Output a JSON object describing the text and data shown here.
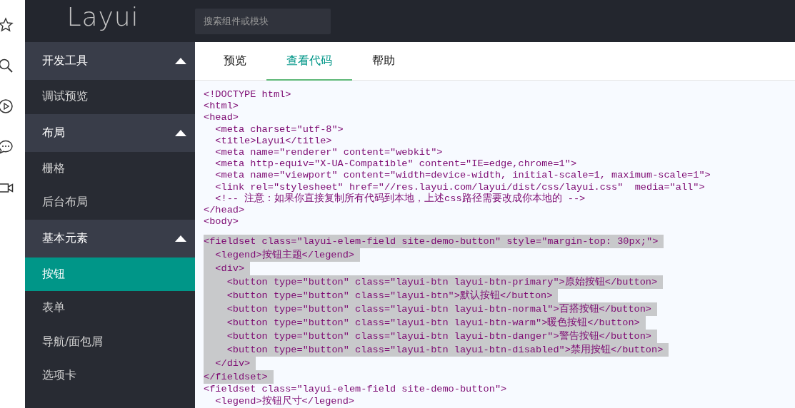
{
  "logo": "Layui",
  "search": {
    "placeholder": "搜索组件或模块"
  },
  "sidebar": {
    "groups": [
      {
        "title": "开发工具",
        "expanded": true,
        "items": [
          {
            "label": "调试预览",
            "selected": false
          }
        ]
      },
      {
        "title": "布局",
        "expanded": true,
        "items": [
          {
            "label": "栅格",
            "selected": false
          },
          {
            "label": "后台布局",
            "selected": false
          }
        ]
      },
      {
        "title": "基本元素",
        "expanded": true,
        "items": [
          {
            "label": "按钮",
            "selected": true
          },
          {
            "label": "表单",
            "selected": false
          },
          {
            "label": "导航/面包屑",
            "selected": false
          },
          {
            "label": "选项卡",
            "selected": false
          }
        ]
      }
    ]
  },
  "tabs": [
    {
      "label": "预览",
      "selected": false
    },
    {
      "label": "查看代码",
      "selected": true
    },
    {
      "label": "帮助",
      "selected": false
    }
  ],
  "code": {
    "lines": [
      {
        "text": "<!DOCTYPE html>",
        "selected": false
      },
      {
        "text": "<html>",
        "selected": false
      },
      {
        "text": "<head>",
        "selected": false
      },
      {
        "text": "  <meta charset=\"utf-8\">",
        "selected": false
      },
      {
        "text": "  <title>Layui</title>",
        "selected": false
      },
      {
        "text": "  <meta name=\"renderer\" content=\"webkit\">",
        "selected": false
      },
      {
        "text": "  <meta http-equiv=\"X-UA-Compatible\" content=\"IE=edge,chrome=1\">",
        "selected": false
      },
      {
        "text": "  <meta name=\"viewport\" content=\"width=device-width, initial-scale=1, maximum-scale=1\">",
        "selected": false
      },
      {
        "text": "  <link rel=\"stylesheet\" href=\"//res.layui.com/layui/dist/css/layui.css\"  media=\"all\">",
        "selected": false
      },
      {
        "text": "  <!-- 注意：如果你直接复制所有代码到本地，上述css路径需要改成你本地的 -->",
        "selected": false
      },
      {
        "text": "</head>",
        "selected": false
      },
      {
        "text": "<body>",
        "selected": false
      },
      {
        "text": "<fieldset class=\"layui-elem-field site-demo-button\" style=\"margin-top: 30px;\">",
        "selected": true
      },
      {
        "text": "  <legend>按钮主题</legend>",
        "selected": true
      },
      {
        "text": "  <div>",
        "selected": true
      },
      {
        "text": "    <button type=\"button\" class=\"layui-btn layui-btn-primary\">原始按钮</button>",
        "selected": true
      },
      {
        "text": "    <button type=\"button\" class=\"layui-btn\">默认按钮</button>",
        "selected": true
      },
      {
        "text": "    <button type=\"button\" class=\"layui-btn layui-btn-normal\">百搭按钮</button>",
        "selected": true
      },
      {
        "text": "    <button type=\"button\" class=\"layui-btn layui-btn-warm\">暖色按钮</button>",
        "selected": true
      },
      {
        "text": "    <button type=\"button\" class=\"layui-btn layui-btn-danger\">警告按钮</button>",
        "selected": true
      },
      {
        "text": "    <button type=\"button\" class=\"layui-btn layui-btn-disabled\">禁用按钮</button>",
        "selected": true
      },
      {
        "text": "  </div>",
        "selected": true
      },
      {
        "text": "</fieldset>",
        "selected": true
      },
      {
        "text": "<fieldset class=\"layui-elem-field site-demo-button\">",
        "selected": false
      },
      {
        "text": "  <legend>按钮尺寸</legend>",
        "selected": false
      }
    ]
  }
}
